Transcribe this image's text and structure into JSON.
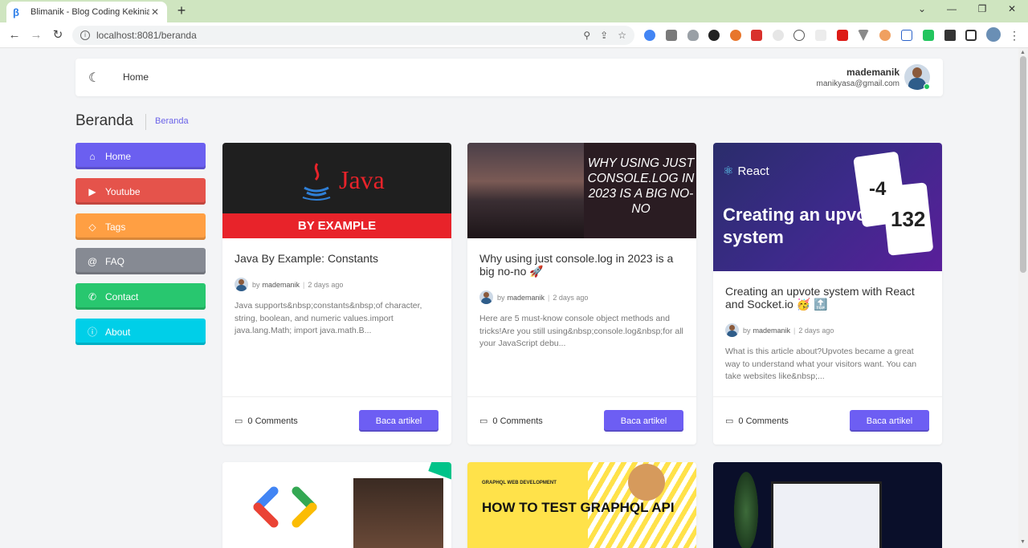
{
  "browser": {
    "tab_title": "Blimanik - Blog Coding Kekinian",
    "url": "localhost:8081/beranda"
  },
  "header": {
    "home_label": "Home",
    "user_name": "mademanik",
    "user_email": "manikyasa@gmail.com"
  },
  "page": {
    "title": "Beranda",
    "breadcrumb": "Beranda"
  },
  "sidebar": {
    "items": [
      {
        "label": "Home",
        "icon": "home-icon",
        "color": "#6b5ff0"
      },
      {
        "label": "Youtube",
        "icon": "youtube-icon",
        "color": "#e5534b"
      },
      {
        "label": "Tags",
        "icon": "tag-icon",
        "color": "#ff9f43"
      },
      {
        "label": "FAQ",
        "icon": "at-icon",
        "color": "#868a93"
      },
      {
        "label": "Contact",
        "icon": "phone-icon",
        "color": "#28c76f"
      },
      {
        "label": "About",
        "icon": "info-icon",
        "color": "#00cfe8"
      }
    ]
  },
  "articles": [
    {
      "title": "Java By Example: Constants",
      "author_prefix": "by",
      "author": "mademanik",
      "time": "2 days ago",
      "excerpt": "Java supports&nbsp;constants&nbsp;of character, string, boolean, and numeric values.import java.lang.Math; import java.math.B...",
      "comments": "0 Comments",
      "button": "Baca artikel",
      "thumb_word": "Java",
      "thumb_banner": "BY EXAMPLE"
    },
    {
      "title": "Why using just console.log in 2023 is a big no-no 🚀",
      "author_prefix": "by",
      "author": "mademanik",
      "time": "2 days ago",
      "excerpt": "Here are 5 must-know console object methods and tricks!Are you still using&nbsp;console.log&nbsp;for all your JavaScript debu...",
      "comments": "0 Comments",
      "button": "Baca artikel",
      "thumb_text": "WHY USING JUST CONSOLE.LOG IN 2023 IS A BIG NO-NO"
    },
    {
      "title": "Creating an upvote system with React and Socket.io 🥳 🔝",
      "author_prefix": "by",
      "author": "mademanik",
      "time": "2 days ago",
      "excerpt": "What is this article about?Upvotes became a great way to understand what your visitors want. You can take websites like&nbsp;...",
      "comments": "0 Comments",
      "button": "Baca artikel",
      "thumb_brand": "React",
      "thumb_headline": "Creating an upvote system",
      "thumb_num_a": "-4",
      "thumb_num_b": "132"
    }
  ],
  "second_row": {
    "graphql_small": "GRAPHQL   WEB DEVELOPMENT",
    "graphql_big": "HOW TO TEST GRAPHQL API"
  }
}
